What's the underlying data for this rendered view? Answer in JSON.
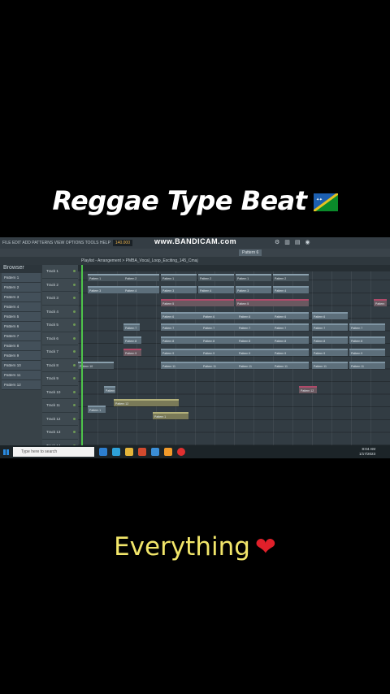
{
  "overlay": {
    "title": "Reggae Type Beat",
    "caption": "Everything",
    "heart_color": "#e0202a",
    "caption_color": "#f2e66a"
  },
  "app": {
    "menu_text": "FILE EDIT ADD PATTERNS VIEW OPTIONS TOOLS HELP",
    "bpm": "140.000",
    "watermark": "www.BANDICAM.com",
    "pattern_selector": "Pattern 6",
    "window_path": "Playlist - Arrangement > PMBA_Vocal_Loop_Exciting_145_Cmaj",
    "browser_header": "Browser"
  },
  "browser_items": [
    "Pattern 1",
    "Pattern 2",
    "Pattern 3",
    "Pattern 4",
    "Pattern 5",
    "Pattern 6",
    "Pattern 7",
    "Pattern 8",
    "Pattern 9",
    "Pattern 10",
    "Pattern 11",
    "Pattern 12"
  ],
  "tracks": [
    "Track 1",
    "Track 2",
    "Track 3",
    "Track 4",
    "Track 5",
    "Track 6",
    "Track 7",
    "Track 8",
    "Track 9",
    "Track 10",
    "Track 11",
    "Track 12",
    "Track 13",
    "Track 14"
  ],
  "taskbar": {
    "search_placeholder": "Type here to search",
    "time": "8:04 AM",
    "date": "1/17/2023"
  }
}
